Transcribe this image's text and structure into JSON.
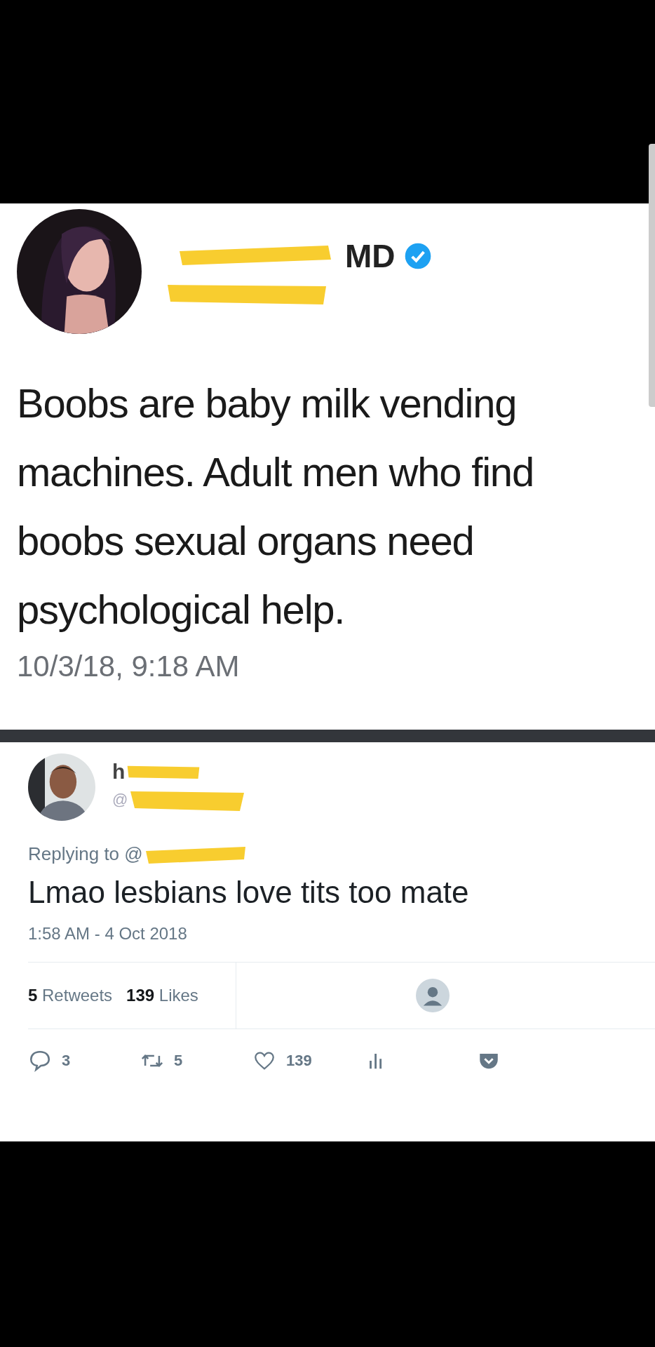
{
  "tweet": {
    "author": {
      "name": "MD",
      "verified": true
    },
    "text": "Boobs are baby milk vending machines. Adult men who find boobs sexual organs need psychological help.",
    "timestamp": "10/3/18, 9:18 AM"
  },
  "reply": {
    "author": {
      "name": "h",
      "handle": "@"
    },
    "replying_to": "Replying to @",
    "text": "Lmao lesbians love tits too mate",
    "timestamp": "1:58 AM - 4 Oct 2018",
    "stats": [
      {
        "count": "5",
        "label": "Retweets"
      },
      {
        "count": "139",
        "label": "Likes"
      }
    ],
    "actions": [
      {
        "kind": "reply",
        "count": "3"
      },
      {
        "kind": "retweet",
        "count": "5"
      },
      {
        "kind": "like",
        "count": "139"
      },
      {
        "kind": "analytics"
      },
      {
        "kind": "pocket"
      }
    ]
  }
}
